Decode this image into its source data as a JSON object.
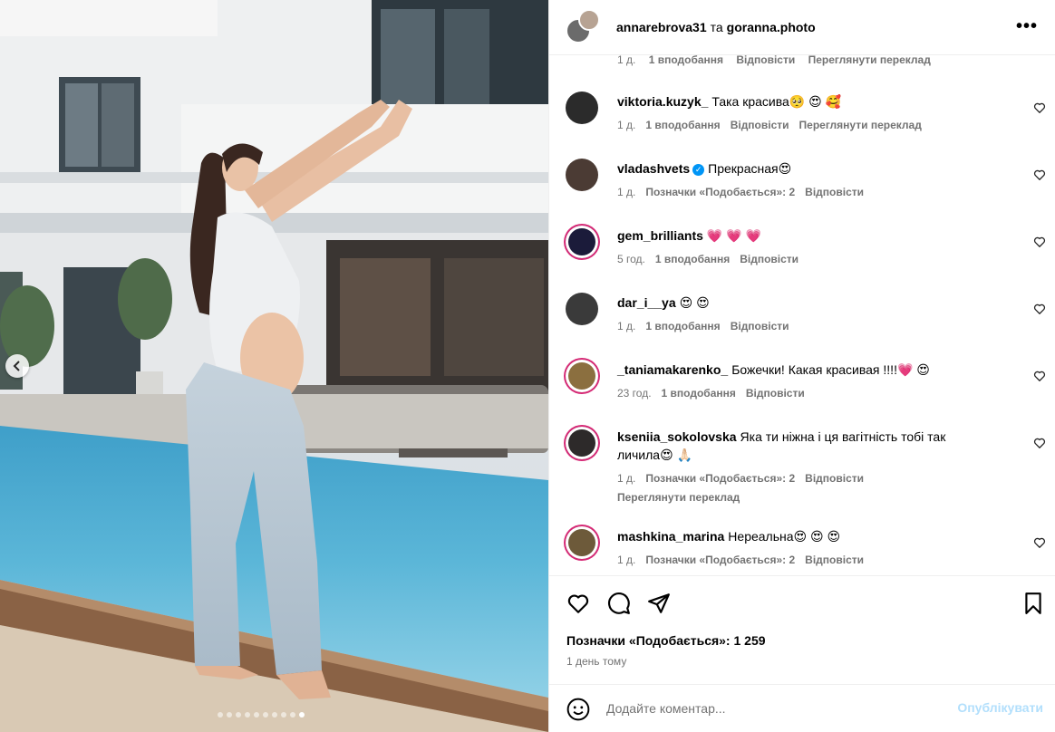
{
  "header": {
    "author1": "annarebrova31",
    "separator": "та",
    "author2": "goranna.photo",
    "more_label": "•••"
  },
  "partial_comment": {
    "time": "1 д.",
    "likes": "1 вподобання",
    "reply": "Відповісти",
    "translate": "Переглянути переклад"
  },
  "comments": [
    {
      "user": "viktoria.kuzyk_",
      "text": "Така красива",
      "emoji": "🥺 😍 🥰",
      "time": "1 д.",
      "likes": "1 вподобання",
      "reply": "Відповісти",
      "translate": "Переглянути переклад"
    },
    {
      "user": "vladashvets",
      "verified": true,
      "text": "Прекрасная",
      "emoji": "😍",
      "time": "1 д.",
      "likes": "Позначки «Подобається»: 2",
      "reply": "Відповісти"
    },
    {
      "user": "gem_brilliants",
      "text": "",
      "emoji": "💗 💗 💗",
      "time": "5 год.",
      "likes": "1 вподобання",
      "reply": "Відповісти"
    },
    {
      "user": "dar_i__ya",
      "text": "",
      "emoji": "😍 😍",
      "time": "1 д.",
      "likes": "1 вподобання",
      "reply": "Відповісти"
    },
    {
      "user": "_taniamakarenko_",
      "text": "Божечки! Какая красивая !!!!",
      "emoji": "💗 😍",
      "time": "23 год.",
      "likes": "1 вподобання",
      "reply": "Відповісти"
    },
    {
      "user": "kseniia_sokolovska",
      "text": "Яка ти ніжна і ця вагітність тобі так личила",
      "emoji": "😍 🙏🏻",
      "time": "1 д.",
      "likes": "Позначки «Подобається»: 2",
      "reply": "Відповісти",
      "translate": "Переглянути переклад"
    },
    {
      "user": "mashkina_marina",
      "text": "Нереальна",
      "emoji": "😍 😍 😍",
      "time": "1 д.",
      "likes": "Позначки «Подобається»: 2",
      "reply": "Відповісти"
    }
  ],
  "footer": {
    "likes": "Позначки «Подобається»: 1 259",
    "posted": "1 день тому"
  },
  "add_comment": {
    "placeholder": "Додайте коментар...",
    "post_label": "Опублікувати"
  },
  "carousel": {
    "total": 10,
    "active_index": 9
  },
  "colors": {
    "accent": "#0095f6",
    "post_button_disabled": "#b2dffc",
    "muted_text": "#737373",
    "verified": "#0095f6"
  }
}
